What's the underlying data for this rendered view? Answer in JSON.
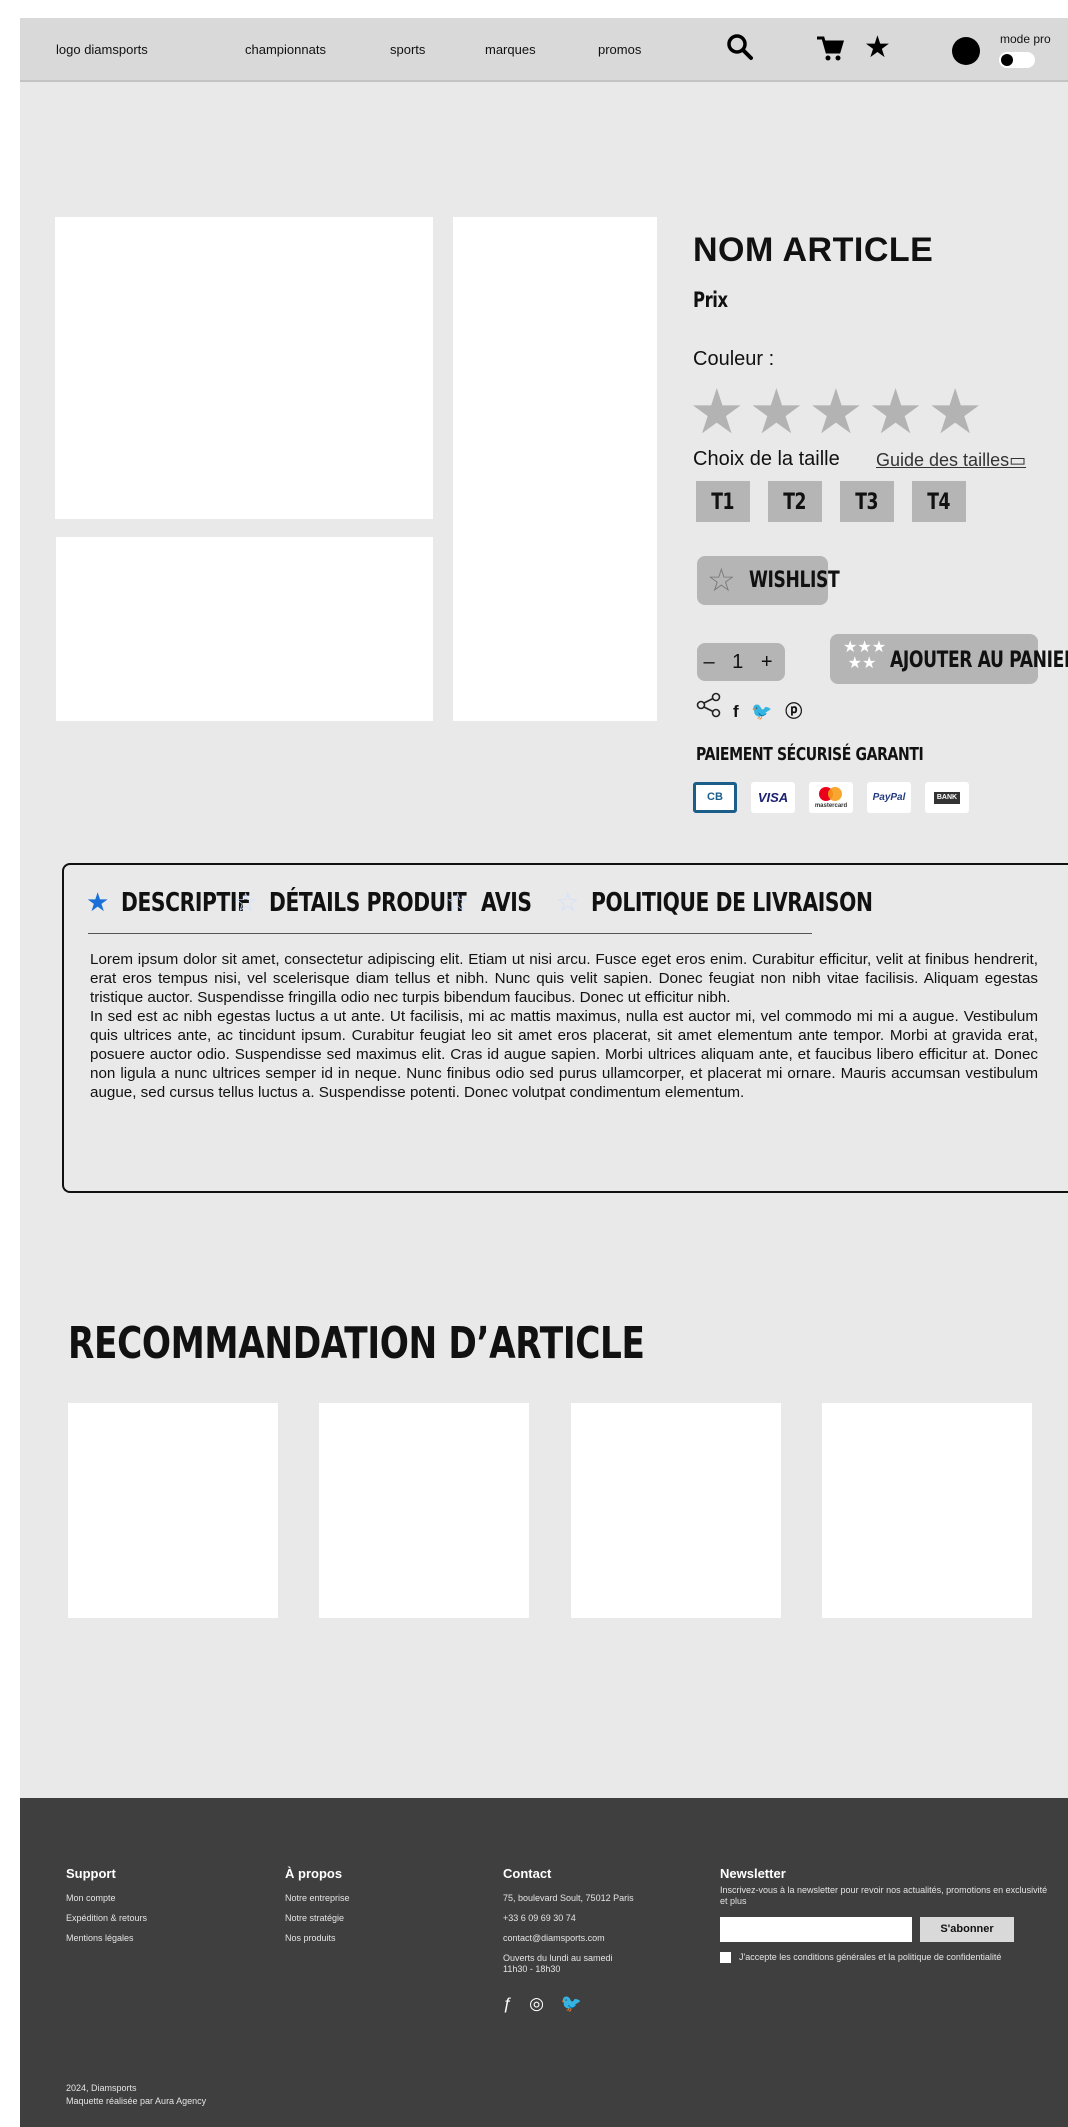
{
  "header": {
    "logo": "logo diamsports",
    "nav": [
      "championnats",
      "sports",
      "marques",
      "promos"
    ],
    "search_icon": "🔍",
    "cart_icon": "🛒",
    "star_icon": "★",
    "mode_label": "mode pro"
  },
  "product": {
    "name": "NOM ARTICLE",
    "price": "Prix",
    "color_label": "Couleur :",
    "color_swatches": "★★★★★",
    "size_label": "Choix de la taille",
    "size_guide": "Guide des tailles▭",
    "sizes": [
      "T1",
      "T2",
      "T3",
      "T4"
    ],
    "wishlist": "WISHLIST",
    "wishlist_icon": "☆",
    "quantity": "– 1 +",
    "add_to_cart": "AJOUTER AU PANIER",
    "cart_icon_stars": "★★★ ★★",
    "share_icon": "⪪",
    "social": "f 🐦 ⓟ",
    "secure_payment": "PAIEMENT SÉCURISÉ GARANTI",
    "payment_methods": [
      "CB",
      "VISA",
      "mastercard",
      "PayPal",
      "BANK"
    ]
  },
  "tabs": {
    "items": [
      {
        "star": "★",
        "label": "DESCRIPTIF"
      },
      {
        "star": "☆",
        "label": "DÉTAILS PRODUIT"
      },
      {
        "star": "☆",
        "label": "AVIS"
      },
      {
        "star": "☆",
        "label": "POLITIQUE DE LIVRAISON"
      }
    ],
    "paragraph1": "Lorem ipsum dolor sit amet, consectetur adipiscing elit. Etiam ut nisi arcu. Fusce eget eros enim. Curabitur efficitur, velit at finibus hendrerit, erat eros tempus nisi, vel scelerisque diam tellus et nibh. Nunc quis velit sapien. Donec feugiat non nibh vitae facilisis. Aliquam egestas tristique auctor. Suspendisse fringilla odio nec turpis bibendum faucibus. Donec ut efficitur nibh.",
    "paragraph2": "In sed est ac nibh egestas luctus a ut ante. Ut facilisis, mi ac mattis maximus, nulla est auctor mi, vel commodo mi mi a augue. Vestibulum quis ultrices ante, ac tincidunt ipsum. Curabitur feugiat leo sit amet eros placerat, sit amet elementum ante tempor. Morbi at gravida erat, posuere auctor odio. Suspendisse sed maximus elit. Cras id augue sapien. Morbi ultrices aliquam ante, et faucibus libero efficitur at. Donec non ligula a nunc ultrices semper id in neque. Nunc finibus odio sed purus ullamcorper, et placerat mi ornare. Mauris accumsan vestibulum augue, sed cursus tellus luctus a. Suspendisse potenti. Donec volutpat condimentum elementum."
  },
  "recommendations": {
    "title": "RECOMMANDATION D’ARTICLE"
  },
  "footer": {
    "support_title": "Support",
    "support_links": [
      "Mon compte",
      "Expédition & retours",
      "Mentions légales"
    ],
    "about_title": "À propos",
    "about_links": [
      "Notre entreprise",
      "Notre stratégie",
      "Nos produits"
    ],
    "contact_title": "Contact",
    "contact_address": "75, boulevard Soult, 75012 Paris",
    "contact_phone": "+33 6 09 69 30 74",
    "contact_email": "contact@diamsports.com",
    "contact_hours_1": "Ouverts du lundi au samedi",
    "contact_hours_2": "11h30 - 18h30",
    "contact_social": "ƒ ◎ 🐦",
    "newsletter_title": "Newsletter",
    "newsletter_text": "Inscrivez-vous à la newsletter pour revoir nos actualités, promotions en exclusivité et plus",
    "subscribe": "S'abonner",
    "terms": "J'accepte les conditions générales et la politique de confidentialité",
    "copyright": "2024, Diamsports",
    "credit": "Maquette réalisée par Aura Agency"
  },
  "colors": {
    "active_tab_star": "#1a6fd8",
    "footer_bg": "#3f3f3f",
    "page_bg": "#e9e9e9"
  }
}
